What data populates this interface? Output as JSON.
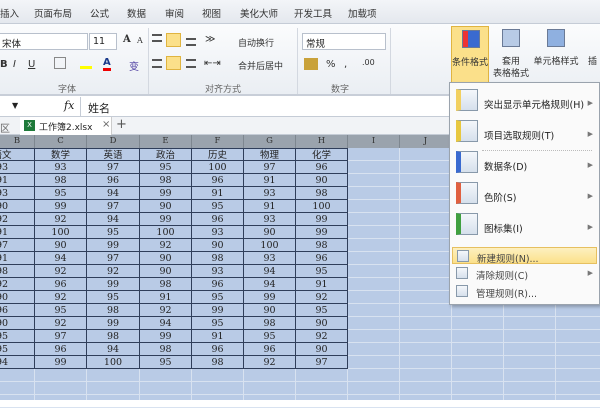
{
  "tabs": [
    "插入",
    "页面布局",
    "公式",
    "数据",
    "审阅",
    "视图",
    "美化大师",
    "开发工具",
    "加载项"
  ],
  "ribbon": {
    "font_name": "宋体",
    "font_size": "11",
    "grow": "A",
    "shrink": "A",
    "bold": "B",
    "italic": "I",
    "underline": "U",
    "font_color": "A",
    "phonetic": "变",
    "group_font": "字体",
    "group_align": "对齐方式",
    "group_number": "数字",
    "wrap": "自动换行",
    "merge": "合并后居中",
    "number_format": "常规",
    "percent": "%",
    "comma": ",",
    "cond_format": "条件格式",
    "table_format": [
      "套用",
      "表格格式"
    ],
    "cell_style": "单元格样式",
    "insert": "插"
  },
  "formula": {
    "fx": "fx",
    "value": "姓名"
  },
  "sheet": {
    "region": "区",
    "file": "工作簿2.xlsx",
    "close": "×",
    "add": "+"
  },
  "columns": [
    "B",
    "C",
    "D",
    "E",
    "F",
    "G",
    "H",
    "I",
    "J"
  ],
  "headers": [
    "语文",
    "数学",
    "英语",
    "政治",
    "历史",
    "物理",
    "化学"
  ],
  "rows": [
    [
      "93",
      "93",
      "97",
      "95",
      "100",
      "97",
      "96"
    ],
    [
      "91",
      "98",
      "96",
      "98",
      "96",
      "91",
      "90"
    ],
    [
      "93",
      "95",
      "94",
      "99",
      "91",
      "93",
      "98"
    ],
    [
      "90",
      "99",
      "97",
      "90",
      "95",
      "91",
      "100"
    ],
    [
      "92",
      "92",
      "94",
      "99",
      "96",
      "93",
      "99"
    ],
    [
      "91",
      "100",
      "95",
      "100",
      "93",
      "90",
      "99"
    ],
    [
      "97",
      "90",
      "99",
      "92",
      "90",
      "100",
      "98"
    ],
    [
      "91",
      "94",
      "97",
      "90",
      "98",
      "93",
      "96"
    ],
    [
      "98",
      "92",
      "92",
      "90",
      "93",
      "94",
      "95"
    ],
    [
      "92",
      "96",
      "99",
      "98",
      "96",
      "94",
      "91"
    ],
    [
      "90",
      "92",
      "95",
      "91",
      "95",
      "99",
      "92"
    ],
    [
      "96",
      "95",
      "98",
      "92",
      "99",
      "90",
      "95"
    ],
    [
      "90",
      "92",
      "99",
      "94",
      "95",
      "98",
      "90"
    ],
    [
      "95",
      "97",
      "98",
      "99",
      "91",
      "95",
      "92"
    ],
    [
      "95",
      "96",
      "94",
      "98",
      "96",
      "96",
      "90"
    ],
    [
      "94",
      "99",
      "100",
      "95",
      "98",
      "92",
      "97"
    ]
  ],
  "menu": {
    "items": [
      {
        "label": "突出显示单元格规则(H)",
        "icon": "highlight-rules-icon"
      },
      {
        "label": "项目选取规则(T)",
        "icon": "top-bottom-rules-icon"
      },
      {
        "label": "数据条(D)",
        "icon": "data-bars-icon"
      },
      {
        "label": "色阶(S)",
        "icon": "color-scales-icon"
      },
      {
        "label": "图标集(I)",
        "icon": "icon-sets-icon"
      }
    ],
    "small": [
      {
        "label": "新建规则(N)...",
        "icon": "new-rule-icon"
      },
      {
        "label": "清除规则(C)",
        "icon": "clear-rules-icon"
      },
      {
        "label": "管理规则(R)...",
        "icon": "manage-rules-icon"
      }
    ]
  }
}
